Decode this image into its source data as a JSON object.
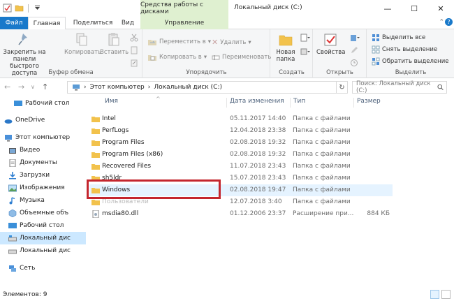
{
  "titlebar": {
    "tools_tab": "Средства работы с дисками",
    "window_title": "Локальный диск (C:)",
    "minimize": "—",
    "maximize": "☐",
    "close": "✕"
  },
  "tabs": {
    "file": "Файл",
    "home": "Главная",
    "share": "Поделиться",
    "view": "Вид",
    "manage": "Управление"
  },
  "ribbon": {
    "clipboard": {
      "pin": "Закрепить на панели быстрого доступа",
      "copy": "Копировать",
      "paste": "Вставить",
      "label": "Буфер обмена"
    },
    "organize": {
      "move_to": "Переместить в",
      "copy_to": "Копировать в",
      "delete": "Удалить",
      "rename": "Переименовать",
      "label": "Упорядочить"
    },
    "new": {
      "new_folder": "Новая папка",
      "label": "Создать"
    },
    "open": {
      "properties": "Свойства",
      "label": "Открыть"
    },
    "select": {
      "select_all": "Выделить все",
      "select_none": "Снять выделение",
      "invert": "Обратить выделение",
      "label": "Выделить"
    }
  },
  "address": {
    "crumb1": "Этот компьютер",
    "crumb2": "Локальный диск (C:)",
    "search_placeholder": "Поиск: Локальный диск (C:)"
  },
  "sidebar": {
    "items": [
      {
        "label": "Рабочий стол",
        "icon": "desktop-icon"
      },
      {
        "label": "OneDrive",
        "icon": "onedrive-icon"
      },
      {
        "label": "Этот компьютер",
        "icon": "computer-icon"
      },
      {
        "label": "Видео",
        "icon": "video-icon"
      },
      {
        "label": "Документы",
        "icon": "documents-icon"
      },
      {
        "label": "Загрузки",
        "icon": "downloads-icon"
      },
      {
        "label": "Изображения",
        "icon": "pictures-icon"
      },
      {
        "label": "Музыка",
        "icon": "music-icon"
      },
      {
        "label": "Объемные объ",
        "icon": "3d-objects-icon"
      },
      {
        "label": "Рабочий стол",
        "icon": "desktop-icon"
      },
      {
        "label": "Локальный дис",
        "icon": "drive-icon"
      },
      {
        "label": "Локальный дис",
        "icon": "drive-icon"
      },
      {
        "label": "Сеть",
        "icon": "network-icon"
      }
    ]
  },
  "columns": {
    "name": "Имя",
    "date": "Дата изменения",
    "type": "Тип",
    "size": "Размер"
  },
  "files": [
    {
      "name": "Intel",
      "date": "05.11.2017 14:40",
      "type": "Папка с файлами",
      "size": ""
    },
    {
      "name": "PerfLogs",
      "date": "12.04.2018 23:38",
      "type": "Папка с файлами",
      "size": ""
    },
    {
      "name": "Program Files",
      "date": "02.08.2018 19:32",
      "type": "Папка с файлами",
      "size": ""
    },
    {
      "name": "Program Files (x86)",
      "date": "02.08.2018 19:32",
      "type": "Папка с файлами",
      "size": ""
    },
    {
      "name": "Recovered Files",
      "date": "11.07.2018 23:43",
      "type": "Папка с файлами",
      "size": ""
    },
    {
      "name": "sh5ldr",
      "date": "15.07.2018 23:43",
      "type": "Папка с файлами",
      "size": ""
    },
    {
      "name": "Windows",
      "date": "02.08.2018 19:47",
      "type": "Папка с файлами",
      "size": ""
    },
    {
      "name": "Пользователи",
      "date": "12.07.2018 3:40",
      "type": "Папка с файлами",
      "size": ""
    },
    {
      "name": "msdia80.dll",
      "date": "01.12.2006 23:37",
      "type": "Расширение при...",
      "size": "884 КБ"
    }
  ],
  "status": {
    "items_count": "Элементов: 9"
  },
  "colors": {
    "accent": "#1979ca",
    "highlight_box": "#c4262e",
    "tools_tab_bg": "#dff0d0",
    "folder": "#f2c24c"
  }
}
